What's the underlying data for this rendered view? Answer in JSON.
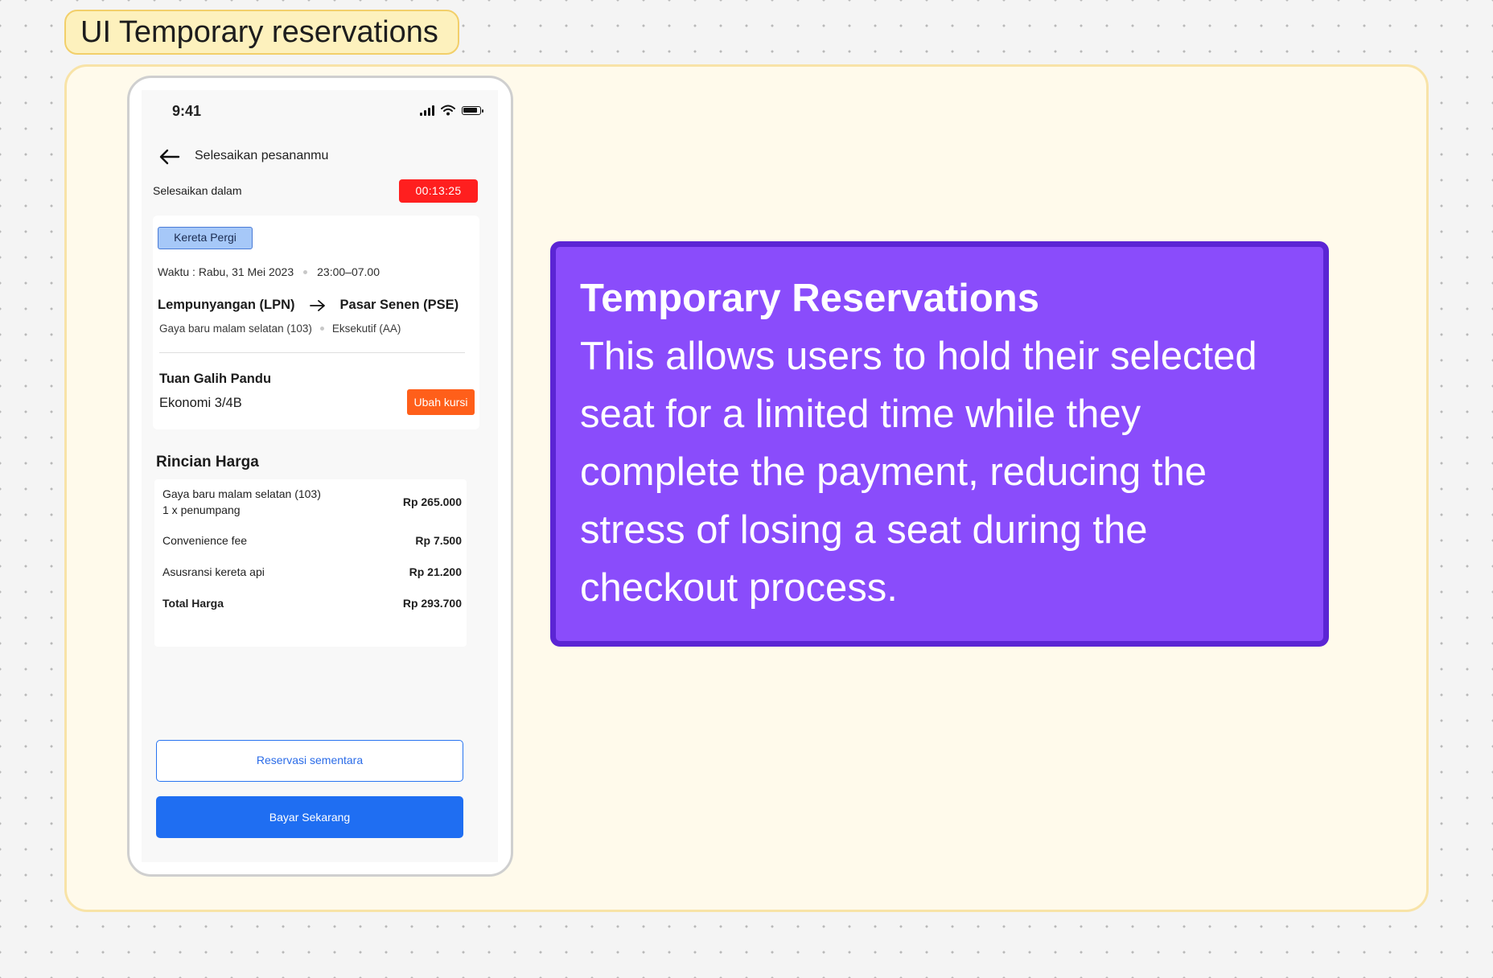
{
  "frame": {
    "label": "UI Temporary reservations"
  },
  "phone": {
    "status": {
      "time": "9:41"
    },
    "header": {
      "title": "Selesaikan pesananmu"
    },
    "deadline": {
      "label": "Selesaikan dalam",
      "timer": "00:13:25"
    },
    "trip": {
      "tag": "Kereta Pergi",
      "datetime": "Waktu : Rabu, 31 Mei 2023",
      "time_range": "23:00–07.00",
      "origin": "Lempunyangan (LPN)",
      "destination": "Pasar Senen (PSE)",
      "train": "Gaya baru malam selatan (103)",
      "class": "Eksekutif (AA)",
      "passenger_name": "Tuan Galih Pandu",
      "seat": "Ekonomi 3/4B",
      "change_seat_label": "Ubah kursi"
    },
    "price": {
      "title": "Rincian Harga",
      "rows": [
        {
          "label": "Gaya baru malam selatan (103)",
          "sublabel": "1 x penumpang",
          "value": "Rp 265.000"
        },
        {
          "label": "Convenience fee",
          "value": "Rp 7.500"
        },
        {
          "label": "Asusransi kereta api",
          "value": "Rp 21.200"
        },
        {
          "label": "Total Harga",
          "value": "Rp 293.700"
        }
      ]
    },
    "actions": {
      "reserve_label": "Reservasi sementara",
      "pay_label": "Bayar Sekarang"
    }
  },
  "callout": {
    "title": "Temporary Reservations",
    "body": "This allows users to hold their selected seat for a limited time while they complete the payment, reducing the stress of losing a seat during the checkout process."
  },
  "colors": {
    "timer_bg": "#ff1f1f",
    "change_seat_bg": "#ff5f1a",
    "primary": "#1f6ef2",
    "callout_bg": "#8a4cfb",
    "callout_border": "#5b25d4",
    "frame_bg": "#fffaeb"
  },
  "icons": [
    "back-arrow-icon",
    "signal-icon",
    "wifi-icon",
    "battery-icon",
    "route-arrow-icon"
  ]
}
